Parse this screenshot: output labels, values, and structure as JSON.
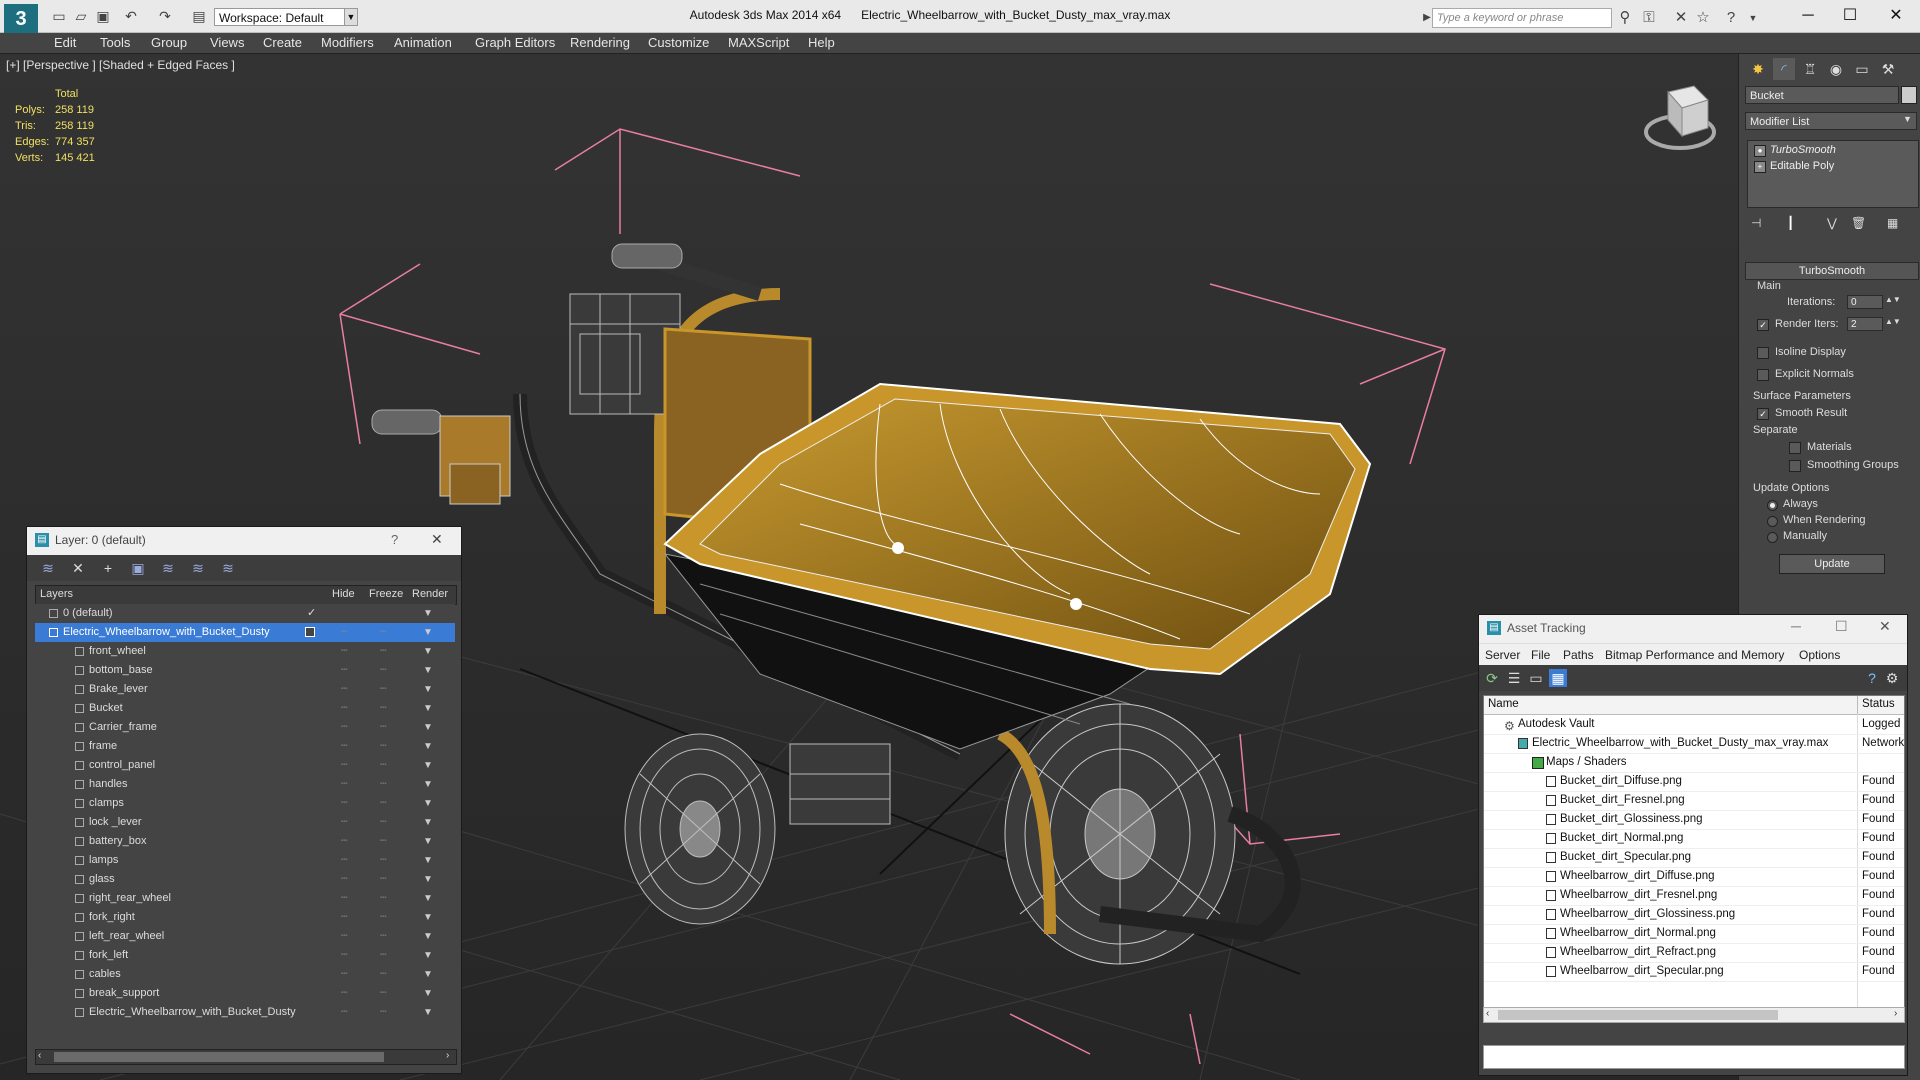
{
  "titlebar": {
    "app_title": "Autodesk 3ds Max  2014 x64",
    "file_title": "Electric_Wheelbarrow_with_Bucket_Dusty_max_vray.max",
    "workspace": "Workspace: Default",
    "search_placeholder": "Type a keyword or phrase",
    "logo": "3"
  },
  "menu": [
    "Edit",
    "Tools",
    "Group",
    "Views",
    "Create",
    "Modifiers",
    "Animation",
    "Graph Editors",
    "Rendering",
    "Customize",
    "MAXScript",
    "Help"
  ],
  "viewport": {
    "label": "[+] [Perspective ] [Shaded + Edged Faces ]",
    "stats": {
      "header": "Total",
      "rows": [
        {
          "label": "Polys:",
          "value": "258 119"
        },
        {
          "label": "Tris:",
          "value": "258 119"
        },
        {
          "label": "Edges:",
          "value": "774 357"
        },
        {
          "label": "Verts:",
          "value": "145 421"
        }
      ]
    }
  },
  "command_panel": {
    "object_name": "Bucket",
    "modifier_list": "Modifier List",
    "stack": [
      "TurboSmooth",
      "Editable Poly"
    ],
    "turbosmooth": {
      "title": "TurboSmooth",
      "main": "Main",
      "iterations_label": "Iterations:",
      "iterations": "0",
      "render_iters_label": "Render Iters:",
      "render_iters": "2",
      "isoline": "Isoline Display",
      "explicit": "Explicit Normals",
      "surface": "Surface Parameters",
      "smooth_result": "Smooth Result",
      "separate": "Separate",
      "materials": "Materials",
      "smoothing_groups": "Smoothing Groups",
      "update_options": "Update Options",
      "always": "Always",
      "when_rendering": "When Rendering",
      "manually": "Manually",
      "update": "Update"
    }
  },
  "layer_dialog": {
    "title": "Layer: 0 (default)",
    "help": "?",
    "close": "✕",
    "columns": {
      "layers": "Layers",
      "hide": "Hide",
      "freeze": "Freeze",
      "render": "Render"
    },
    "rows": [
      {
        "name": "0 (default)"
      },
      {
        "name": "Electric_Wheelbarrow_with_Bucket_Dusty"
      },
      {
        "name": "front_wheel"
      },
      {
        "name": "bottom_base"
      },
      {
        "name": "Brake_lever"
      },
      {
        "name": "Bucket"
      },
      {
        "name": "Carrier_frame"
      },
      {
        "name": "frame"
      },
      {
        "name": "control_panel"
      },
      {
        "name": "handles"
      },
      {
        "name": "clamps"
      },
      {
        "name": "lock _lever"
      },
      {
        "name": "battery_box"
      },
      {
        "name": "lamps"
      },
      {
        "name": "glass"
      },
      {
        "name": "right_rear_wheel"
      },
      {
        "name": "fork_right"
      },
      {
        "name": "left_rear_wheel"
      },
      {
        "name": "fork_left"
      },
      {
        "name": "cables"
      },
      {
        "name": "break_support"
      },
      {
        "name": "Electric_Wheelbarrow_with_Bucket_Dusty"
      }
    ]
  },
  "asset_tracking": {
    "title": "Asset Tracking",
    "menu": [
      "Server",
      "File",
      "Paths",
      "Bitmap Performance and Memory",
      "Options"
    ],
    "columns": {
      "name": "Name",
      "status": "Status"
    },
    "rows": [
      {
        "name": "Autodesk Vault",
        "status": "Logged C"
      },
      {
        "name": "Electric_Wheelbarrow_with_Bucket_Dusty_max_vray.max",
        "status": "Network"
      },
      {
        "name": "Maps / Shaders",
        "status": ""
      },
      {
        "name": "Bucket_dirt_Diffuse.png",
        "status": "Found"
      },
      {
        "name": "Bucket_dirt_Fresnel.png",
        "status": "Found"
      },
      {
        "name": "Bucket_dirt_Glossiness.png",
        "status": "Found"
      },
      {
        "name": "Bucket_dirt_Normal.png",
        "status": "Found"
      },
      {
        "name": "Bucket_dirt_Specular.png",
        "status": "Found"
      },
      {
        "name": "Wheelbarrow_dirt_Diffuse.png",
        "status": "Found"
      },
      {
        "name": "Wheelbarrow_dirt_Fresnel.png",
        "status": "Found"
      },
      {
        "name": "Wheelbarrow_dirt_Glossiness.png",
        "status": "Found"
      },
      {
        "name": "Wheelbarrow_dirt_Normal.png",
        "status": "Found"
      },
      {
        "name": "Wheelbarrow_dirt_Refract.png",
        "status": "Found"
      },
      {
        "name": "Wheelbarrow_dirt_Specular.png",
        "status": "Found"
      }
    ]
  },
  "colors": {
    "selection": "#3a7bd5",
    "stats": "#f0e060",
    "bucket": "#c8962a",
    "bbox": "#ff8fb0"
  }
}
